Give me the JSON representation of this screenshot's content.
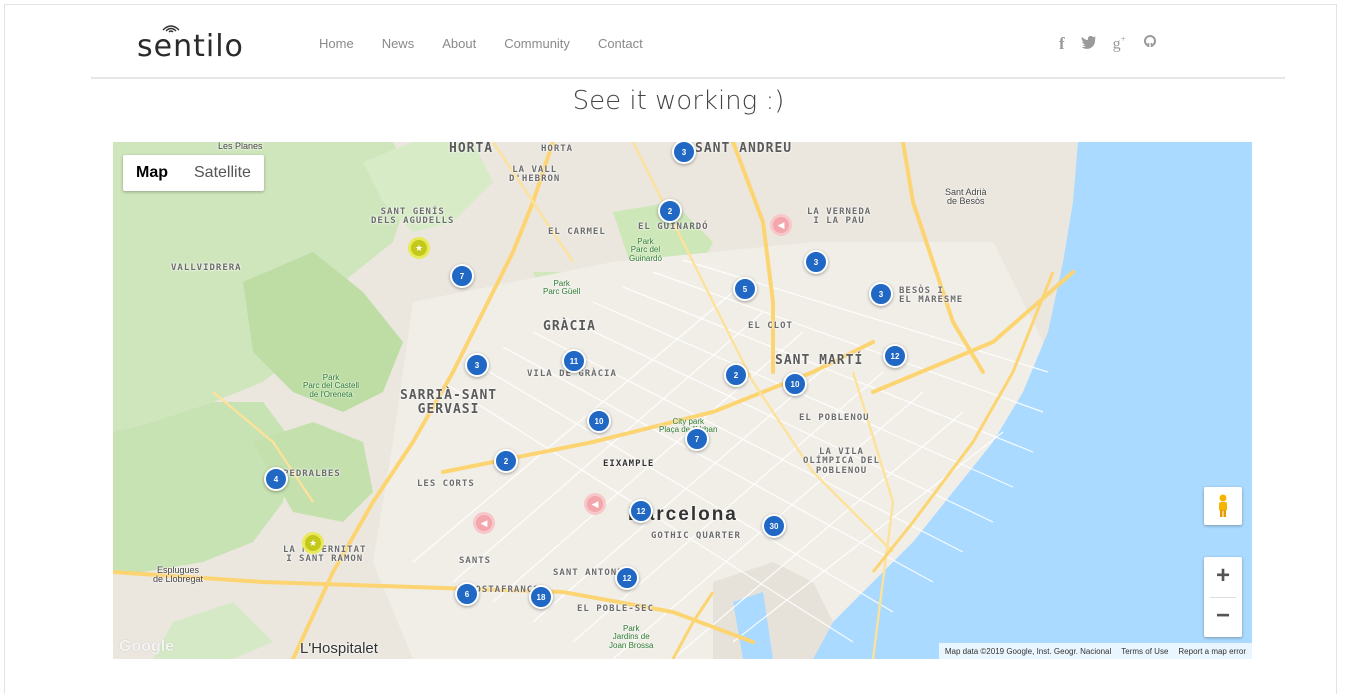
{
  "header": {
    "logo_text": "sentilo",
    "nav": [
      {
        "label": "Home"
      },
      {
        "label": "News"
      },
      {
        "label": "About"
      },
      {
        "label": "Community"
      },
      {
        "label": "Contact"
      }
    ],
    "social_icons": [
      "facebook-icon",
      "twitter-icon",
      "google-plus-icon",
      "github-icon"
    ]
  },
  "page": {
    "heading": "See it working :)"
  },
  "map": {
    "type_control": {
      "map": "Map",
      "satellite": "Satellite"
    },
    "attribution": {
      "data": "Map data ©2019 Google, Inst. Geogr. Nacional",
      "terms": "Terms of Use",
      "report": "Report a map error"
    },
    "watermark": "Google",
    "zoom": {
      "in": "+",
      "out": "−"
    },
    "labels": {
      "horta": "HORTA",
      "sant_andreu": "SANT ANDREU",
      "la_vall_hebron": "LA VALL\nD'HEBRON",
      "horta_small": "HORTA",
      "les_planes": "Les Planes",
      "sant_genis": "SANT GENÍS\nDELS AGUDELLS",
      "el_carmel": "EL CARMEL",
      "el_guinardo": "EL GUINARDÓ",
      "la_verneda": "LA VERNEDA\nI LA PAU",
      "sant_adria": "Sant Adrià\nde Besòs",
      "vallvidrera": "VALLVIDRERA",
      "park_guinardo": "Park\nParc del\nGuinardó",
      "park_guell": "Park\nParc Güell",
      "besos": "BESÒS I\nEL MARESME",
      "gracia": "GRÀCIA",
      "el_clot": "EL CLOT",
      "sant_marti": "SANT MARTÍ",
      "vila_gracia": "VILA DE GRÀCIA",
      "park_castell": "Park\nParc del Castell\nde l'Oreneta",
      "sarria": "SARRIÀ-SANT\nGERVASI",
      "el_poblenou": "EL POBLENOU",
      "city_park": "City park\nPlaça de l'Urban",
      "eixample": "EIXAMPLE",
      "la_vila_olimpica": "LA VILA\nOLÍMPICA DEL\nPOBLENOU",
      "pedralbes": "PEDRALBES",
      "les_corts": "LES CORTS",
      "barcelona": "Barcelona",
      "gothic": "GOTHIC QUARTER",
      "maternitat": "LA MATERNITAT\nI SANT RAMON",
      "esplugues": "Esplugues\nde Llobregat",
      "sants": "SANTS",
      "sant_antoni": "SANT ANTONI",
      "hostafrancs": "HOSTAFRANCS",
      "poble_sec": "EL POBLE-SEC",
      "park_joan": "Park\nJardins de\nJoan Brossa",
      "hospitalet": "L'Hospitalet"
    },
    "clusters": [
      {
        "count": "3"
      },
      {
        "count": "2"
      },
      {
        "count": "7"
      },
      {
        "count": "3"
      },
      {
        "count": "5"
      },
      {
        "count": "3"
      },
      {
        "count": "3"
      },
      {
        "count": "11"
      },
      {
        "count": "2"
      },
      {
        "count": "12"
      },
      {
        "count": "10"
      },
      {
        "count": "10"
      },
      {
        "count": "7"
      },
      {
        "count": "2"
      },
      {
        "count": "4"
      },
      {
        "count": "12"
      },
      {
        "count": "30"
      },
      {
        "count": "6"
      },
      {
        "count": "18"
      },
      {
        "count": "12"
      }
    ],
    "markers": {
      "yellow": 2,
      "pink": 3
    }
  },
  "colors": {
    "cluster": "#2068c4",
    "sea": "#aadaff",
    "land": "#ebe7df",
    "park": "#c8e6b5",
    "road_major": "#fcd471",
    "sensor_yellow": "#c3c81a",
    "sensor_pink": "#f3a6ab"
  }
}
